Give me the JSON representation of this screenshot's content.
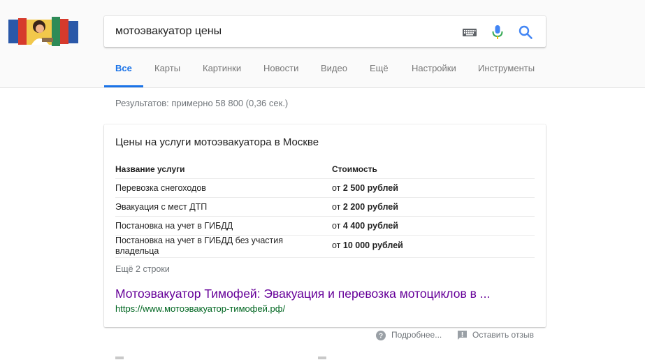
{
  "search": {
    "query": "мотоэвакуатор цены"
  },
  "icons": {
    "keyboard": "keyboard-icon",
    "mic": "microphone-icon",
    "search": "search-icon",
    "help": "help-circle-icon",
    "feedback": "feedback-icon"
  },
  "colors": {
    "accent": "#1a73e8",
    "visited_link": "#660099",
    "url": "#006621",
    "muted": "#70757a"
  },
  "tabs": [
    {
      "label": "Все",
      "active": true
    },
    {
      "label": "Карты"
    },
    {
      "label": "Картинки"
    },
    {
      "label": "Новости"
    },
    {
      "label": "Видео"
    },
    {
      "label": "Ещё"
    },
    {
      "label": "Настройки"
    },
    {
      "label": "Инструменты"
    }
  ],
  "stats": "Результатов: примерно 58 800 (0,36 сек.)",
  "card": {
    "title": "Цены на услуги мотоэвакуатора в Москве",
    "headers": [
      "Название услуги",
      "Стоимость"
    ],
    "rows": [
      {
        "service": "Перевозка снегоходов",
        "price_prefix": "от",
        "price": "2 500 рублей"
      },
      {
        "service": "Эвакуация с мест ДТП",
        "price_prefix": "от",
        "price": "2 200 рублей"
      },
      {
        "service": "Постановка на учет в ГИБДД",
        "price_prefix": "от",
        "price": "4 400 рублей"
      },
      {
        "service": "Постановка на учет в ГИБДД без участия владельца",
        "price_prefix": "от",
        "price": "10 000 рублей"
      }
    ],
    "more_rows": "Ещё 2 строки",
    "result_title": "Мотоэвакуатор Тимофей: Эвакуация и перевозка мотоциклов в ...",
    "result_url": "https://www.мотоэвакуатор-тимофей.рф/"
  },
  "feedback": {
    "more": "Подробнее...",
    "leave": "Оставить отзыв"
  }
}
